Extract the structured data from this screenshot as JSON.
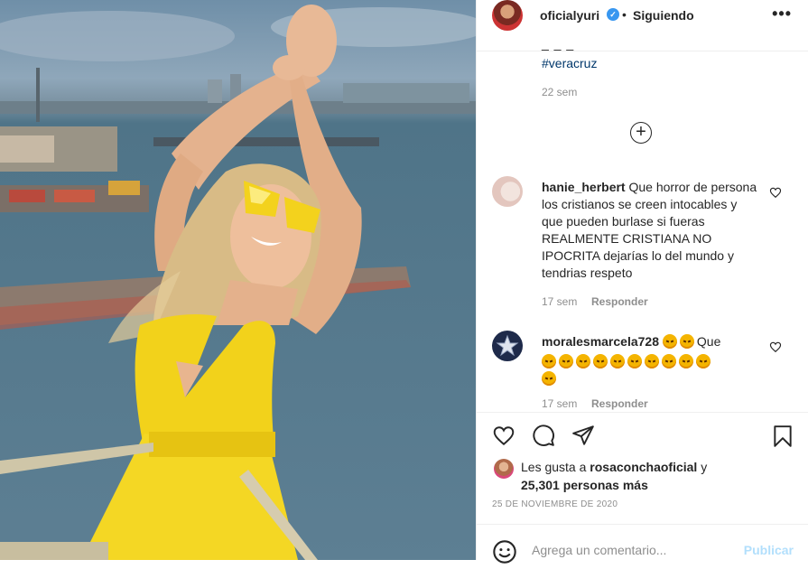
{
  "post": {
    "username": "oficialyuri",
    "verified_icon": "verified-badge-icon",
    "separator": "•",
    "follow_status": "Siguiendo",
    "more_label": "•••"
  },
  "caption": {
    "clipped_text": "_ _ _",
    "hashtag": "#veracruz",
    "time": "22 sem"
  },
  "load_more_label": "+",
  "comments": [
    {
      "username": "hanie_herbert",
      "text": "Que horror de persona los cristianos se creen intocables y que pueden burlase si fueras REALMENTE CRISTIANA NO IPOCRITA dejarías lo del mundo y tendrias respeto",
      "time": "17 sem",
      "reply": "Responder"
    },
    {
      "username": "moralesmarcela728",
      "text": "Que",
      "emoji_name": "angry-face-emoji",
      "emoji_before": 2,
      "emoji_after": 11,
      "time": "17 sem",
      "reply": "Responder"
    }
  ],
  "likes": {
    "prefix": "Les gusta a",
    "user": "rosaconchaoficial",
    "conj": "y",
    "count_text": "25,301 personas más"
  },
  "date": "25 DE NOVIEMBRE DE 2020",
  "add_comment": {
    "placeholder": "Agrega un comentario...",
    "publish": "Publicar"
  },
  "colors": {
    "dress": "#f2d21b",
    "sea": "#5d7f93",
    "link": "#00376b",
    "publish_disabled": "#b2dffc"
  }
}
